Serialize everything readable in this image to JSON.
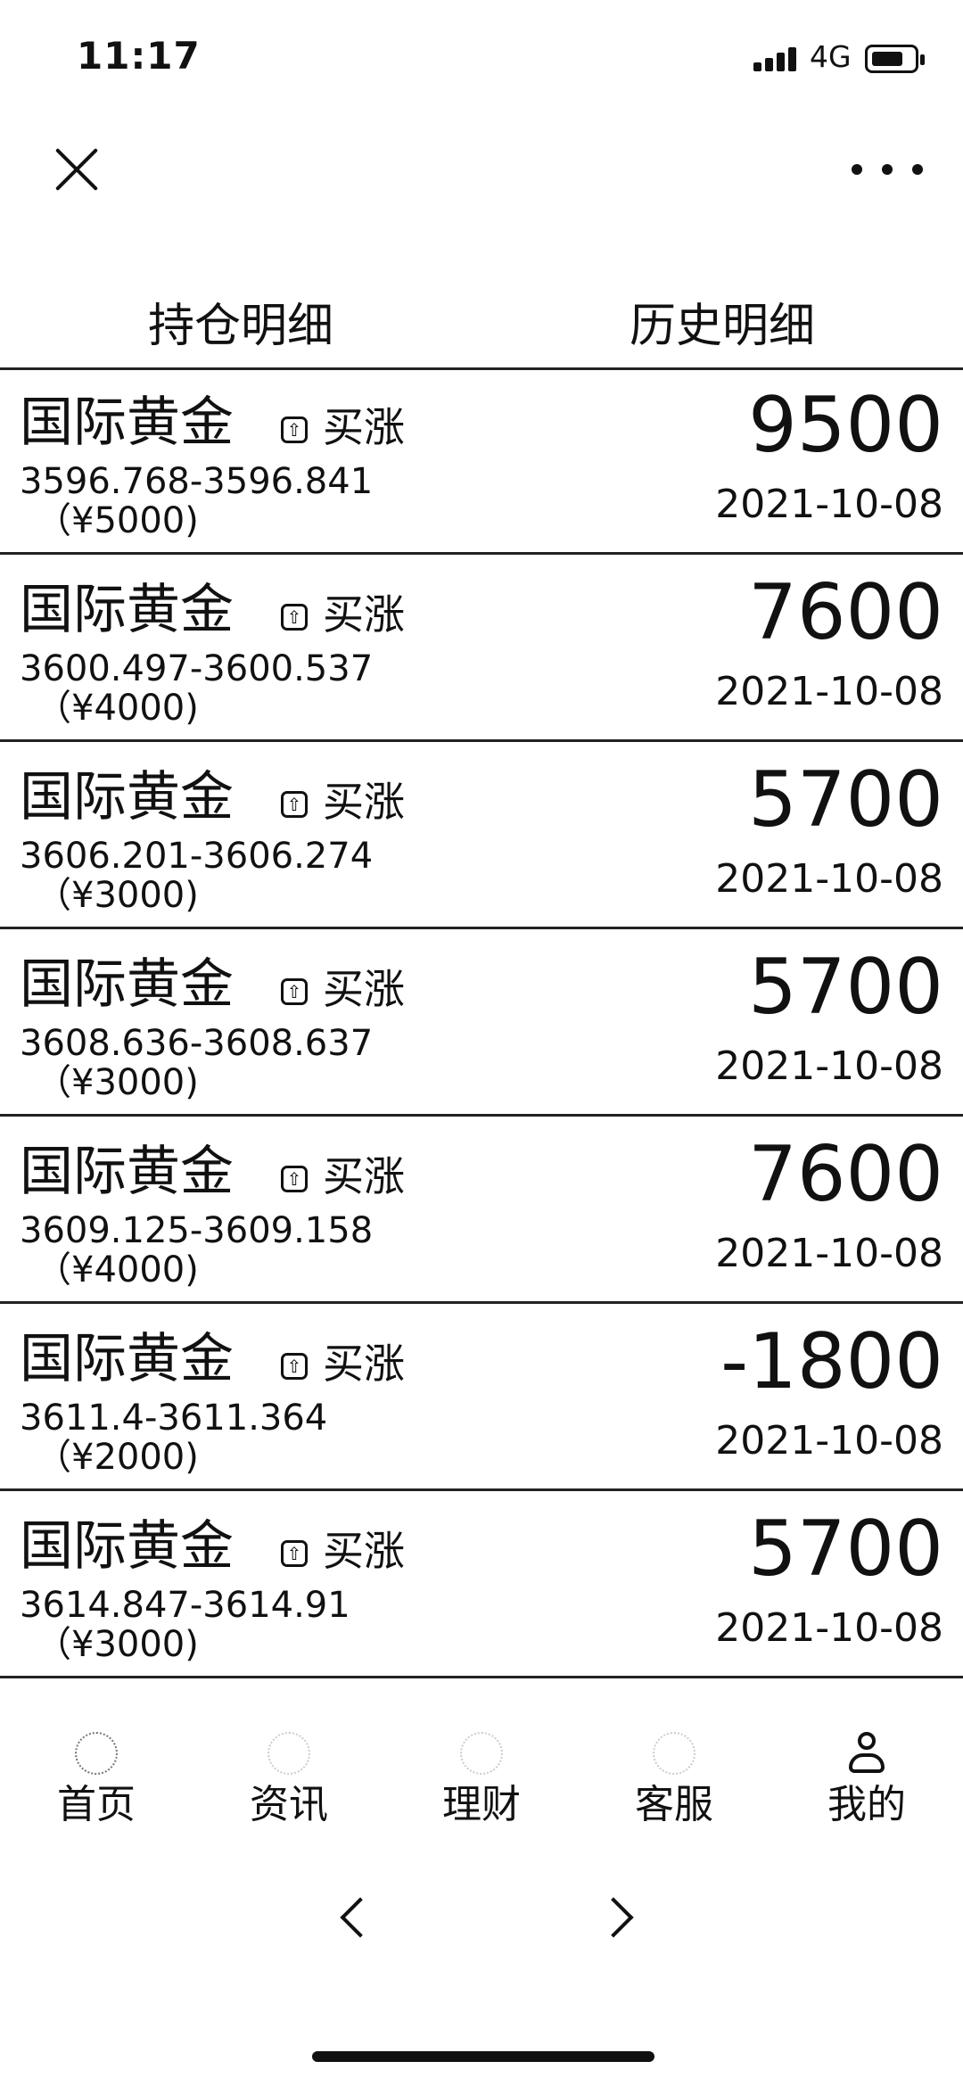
{
  "status_bar": {
    "time": "11:17",
    "network": "4G"
  },
  "tabs": [
    {
      "label": "持仓明细"
    },
    {
      "label": "历史明细"
    }
  ],
  "records": [
    {
      "name": "国际黄金",
      "type": "买涨",
      "range": "3596.768-3596.841",
      "amount": "（¥5000)",
      "profit": "9500",
      "date": "2021-10-08"
    },
    {
      "name": "国际黄金",
      "type": "买涨",
      "range": "3600.497-3600.537",
      "amount": "（¥4000)",
      "profit": "7600",
      "date": "2021-10-08"
    },
    {
      "name": "国际黄金",
      "type": "买涨",
      "range": "3606.201-3606.274",
      "amount": "（¥3000)",
      "profit": "5700",
      "date": "2021-10-08"
    },
    {
      "name": "国际黄金",
      "type": "买涨",
      "range": "3608.636-3608.637",
      "amount": "（¥3000)",
      "profit": "5700",
      "date": "2021-10-08"
    },
    {
      "name": "国际黄金",
      "type": "买涨",
      "range": "3609.125-3609.158",
      "amount": "（¥4000)",
      "profit": "7600",
      "date": "2021-10-08"
    },
    {
      "name": "国际黄金",
      "type": "买涨",
      "range": "3611.4-3611.364",
      "amount": "（¥2000)",
      "profit": "-1800",
      "date": "2021-10-08"
    },
    {
      "name": "国际黄金",
      "type": "买涨",
      "range": "3614.847-3614.91",
      "amount": "（¥3000)",
      "profit": "5700",
      "date": "2021-10-08"
    }
  ],
  "bottom_nav": [
    {
      "label": "首页",
      "icon": "home-icon"
    },
    {
      "label": "资讯",
      "icon": "news-icon"
    },
    {
      "label": "理财",
      "icon": "finance-icon"
    },
    {
      "label": "客服",
      "icon": "service-icon"
    },
    {
      "label": "我的",
      "icon": "user-icon"
    }
  ]
}
